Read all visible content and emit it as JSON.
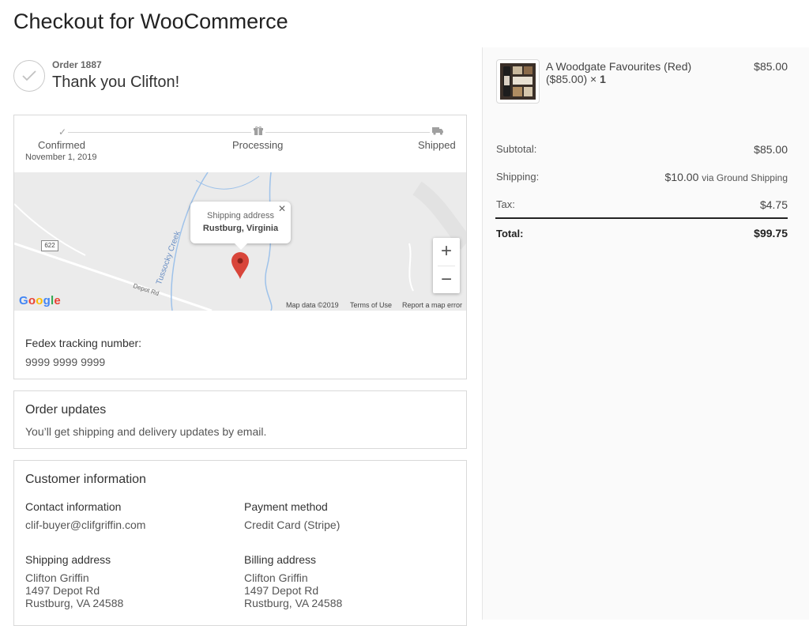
{
  "page": {
    "title": "Checkout for WooCommerce"
  },
  "confirmation": {
    "order_number": "Order 1887",
    "thank_you": "Thank you Clifton!"
  },
  "status": {
    "steps": [
      {
        "label": "Confirmed",
        "date": "November 1, 2019",
        "icon": "checkmark-icon"
      },
      {
        "label": "Processing",
        "icon": "gift-icon"
      },
      {
        "label": "Shipped",
        "icon": "truck-icon"
      }
    ]
  },
  "map": {
    "popup_title": "Shipping address",
    "popup_city": "Rustburg, Virginia",
    "route_badge": "622",
    "road_label": "Depot Rd",
    "creek_label": "Tussocky Creek",
    "logo": "Google",
    "footer": {
      "data": "Map data ©2019",
      "terms": "Terms of Use",
      "report": "Report a map error"
    },
    "zoom_in": "+",
    "zoom_out": "−"
  },
  "tracking": {
    "label": "Fedex tracking number:",
    "number": "9999 9999 9999"
  },
  "updates": {
    "title": "Order updates",
    "text": "You’ll get shipping and delivery updates by email."
  },
  "customer": {
    "title": "Customer information",
    "contact": {
      "label": "Contact information",
      "value": "clif-buyer@clifgriffin.com"
    },
    "payment": {
      "label": "Payment method",
      "value": "Credit Card (Stripe)"
    },
    "shipping": {
      "label": "Shipping address",
      "name": "Clifton Griffin",
      "street": "1497 Depot Rd",
      "city": "Rustburg, VA 24588"
    },
    "billing": {
      "label": "Billing address",
      "name": "Clifton Griffin",
      "street": "1497 Depot Rd",
      "city": "Rustburg, VA 24588"
    }
  },
  "summary": {
    "item": {
      "name": "A Woodgate Favourites (Red)",
      "unit": "($85.00) × ",
      "qty": "1",
      "price": "$85.00"
    },
    "subtotal": {
      "label": "Subtotal:",
      "value": "$85.00"
    },
    "shipping": {
      "label": "Shipping:",
      "value": "$10.00",
      "via": "via Ground Shipping"
    },
    "tax": {
      "label": "Tax:",
      "value": "$4.75"
    },
    "total": {
      "label": "Total:",
      "value": "$99.75"
    }
  },
  "colors": {
    "pin": "#d8453a",
    "water": "#9ec2ea",
    "map_bg": "#ebebeb"
  }
}
